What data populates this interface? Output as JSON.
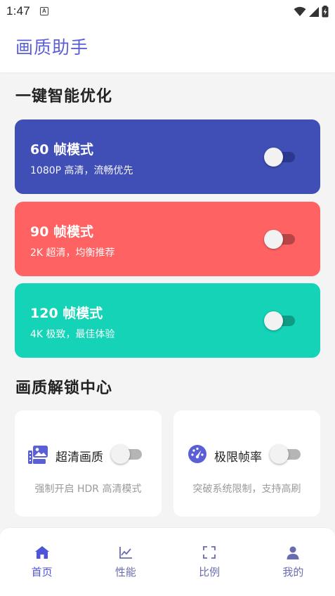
{
  "status": {
    "time": "1:47"
  },
  "app": {
    "title": "画质助手"
  },
  "colors": {
    "accent": "#5b5fd6",
    "card60": "#3f4fb5",
    "card90": "#ff6262",
    "card120": "#14d3b6"
  },
  "sections": {
    "quick": "一键智能优化",
    "unlock": "画质解锁中心"
  },
  "modes": [
    {
      "name": "60 帧模式",
      "desc": "1080P 高清，流畅优先",
      "enabled": false
    },
    {
      "name": "90 帧模式",
      "desc": "2K 超清，均衡推荐",
      "enabled": false
    },
    {
      "name": "120 帧模式",
      "desc": "4K 极致，最佳体验",
      "enabled": false
    }
  ],
  "features": [
    {
      "label": "超清画质",
      "sub": "强制开启 HDR 高清模式",
      "icon": "image-gallery-icon",
      "enabled": false
    },
    {
      "label": "极限帧率",
      "sub": "突破系统限制，支持高刷",
      "icon": "speedometer-icon",
      "enabled": false
    }
  ],
  "nav": [
    {
      "label": "首页",
      "icon": "home-icon",
      "active": true
    },
    {
      "label": "性能",
      "icon": "chart-line-icon",
      "active": false
    },
    {
      "label": "比例",
      "icon": "fullscreen-icon",
      "active": false
    },
    {
      "label": "我的",
      "icon": "person-icon",
      "active": false
    }
  ]
}
